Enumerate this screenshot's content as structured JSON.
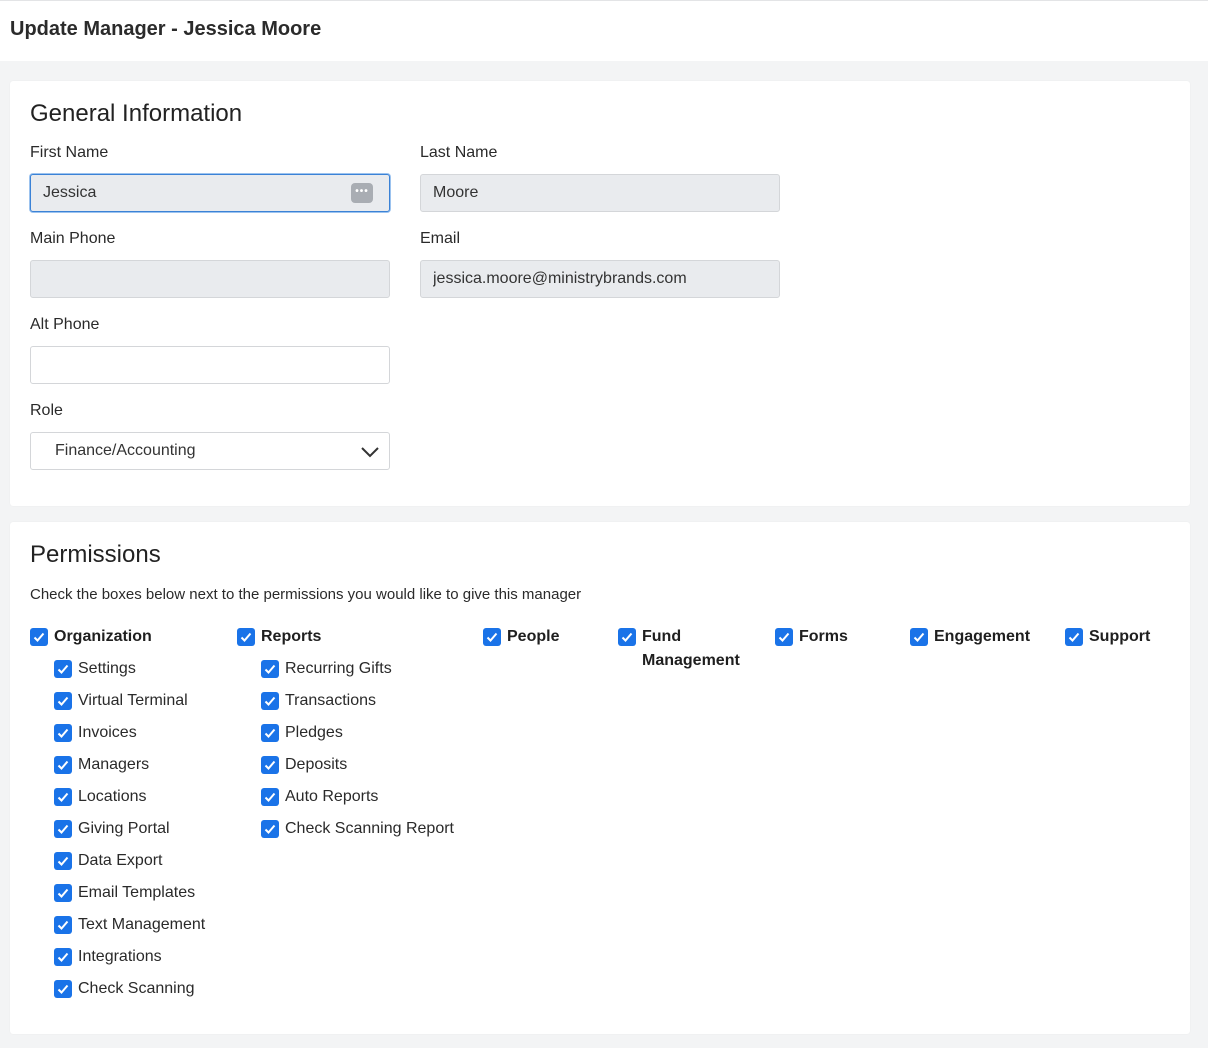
{
  "page": {
    "title": "Update Manager - Jessica Moore"
  },
  "general": {
    "title": "General Information",
    "first_name": {
      "label": "First Name",
      "value": "Jessica"
    },
    "last_name": {
      "label": "Last Name",
      "value": "Moore"
    },
    "main_phone": {
      "label": "Main Phone",
      "value": ""
    },
    "email": {
      "label": "Email",
      "value": "jessica.moore@ministrybrands.com"
    },
    "alt_phone": {
      "label": "Alt Phone",
      "value": ""
    },
    "role": {
      "label": "Role",
      "value": "Finance/Accounting"
    },
    "password_manager_icon": "password-dots-icon"
  },
  "permissions": {
    "title": "Permissions",
    "description": "Check the boxes below next to the permissions you would like to give this manager",
    "accent_color": "#1a73e8",
    "groups": [
      {
        "label": "Organization",
        "checked": true,
        "items": [
          {
            "label": "Settings",
            "checked": true
          },
          {
            "label": "Virtual Terminal",
            "checked": true
          },
          {
            "label": "Invoices",
            "checked": true
          },
          {
            "label": "Managers",
            "checked": true
          },
          {
            "label": "Locations",
            "checked": true
          },
          {
            "label": "Giving Portal",
            "checked": true
          },
          {
            "label": "Data Export",
            "checked": true
          },
          {
            "label": "Email Templates",
            "checked": true
          },
          {
            "label": "Text Management",
            "checked": true
          },
          {
            "label": "Integrations",
            "checked": true
          },
          {
            "label": "Check Scanning",
            "checked": true
          }
        ]
      },
      {
        "label": "Reports",
        "checked": true,
        "items": [
          {
            "label": "Recurring Gifts",
            "checked": true
          },
          {
            "label": "Transactions",
            "checked": true
          },
          {
            "label": "Pledges",
            "checked": true
          },
          {
            "label": "Deposits",
            "checked": true
          },
          {
            "label": "Auto Reports",
            "checked": true
          },
          {
            "label": "Check Scanning Report",
            "checked": true
          }
        ]
      },
      {
        "label": "People",
        "checked": true,
        "items": []
      },
      {
        "label": "Fund Management",
        "label_line1": "Fund",
        "label_line2": "Management",
        "checked": true,
        "items": []
      },
      {
        "label": "Forms",
        "checked": true,
        "items": []
      },
      {
        "label": "Engagement",
        "checked": true,
        "items": []
      },
      {
        "label": "Support",
        "checked": true,
        "items": []
      }
    ]
  }
}
